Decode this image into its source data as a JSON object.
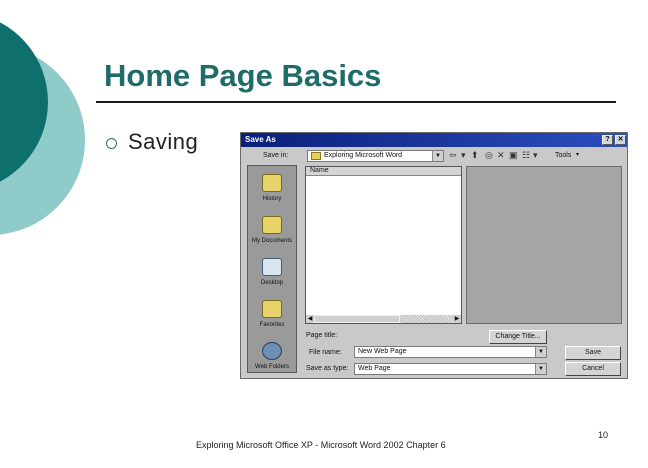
{
  "slide": {
    "title": "Home Page Basics",
    "bullet": "Saving",
    "footer": "Exploring Microsoft Office XP - Microsoft Word 2002 Chapter 6",
    "page_number": "10"
  },
  "colors": {
    "teal_dark": "#0e6f6c",
    "teal_light": "#8fcbc9",
    "title": "#1f6b6a"
  },
  "dialog": {
    "title": "Save As",
    "help_button": "?",
    "close_button": "✕",
    "save_in_label": "Save in:",
    "save_in_value": "Exploring Microsoft Word",
    "tools_label": "Tools",
    "places": [
      "History",
      "My Documents",
      "Desktop",
      "Favorites",
      "Web Folders"
    ],
    "column_name": "Name",
    "page_title_label": "Page title:",
    "change_title_button": "Change Title...",
    "file_name_label": "File name:",
    "file_name_value": "New Web Page",
    "save_as_type_label": "Save as type:",
    "save_as_type_value": "Web Page",
    "save_button": "Save",
    "cancel_button": "Cancel"
  }
}
